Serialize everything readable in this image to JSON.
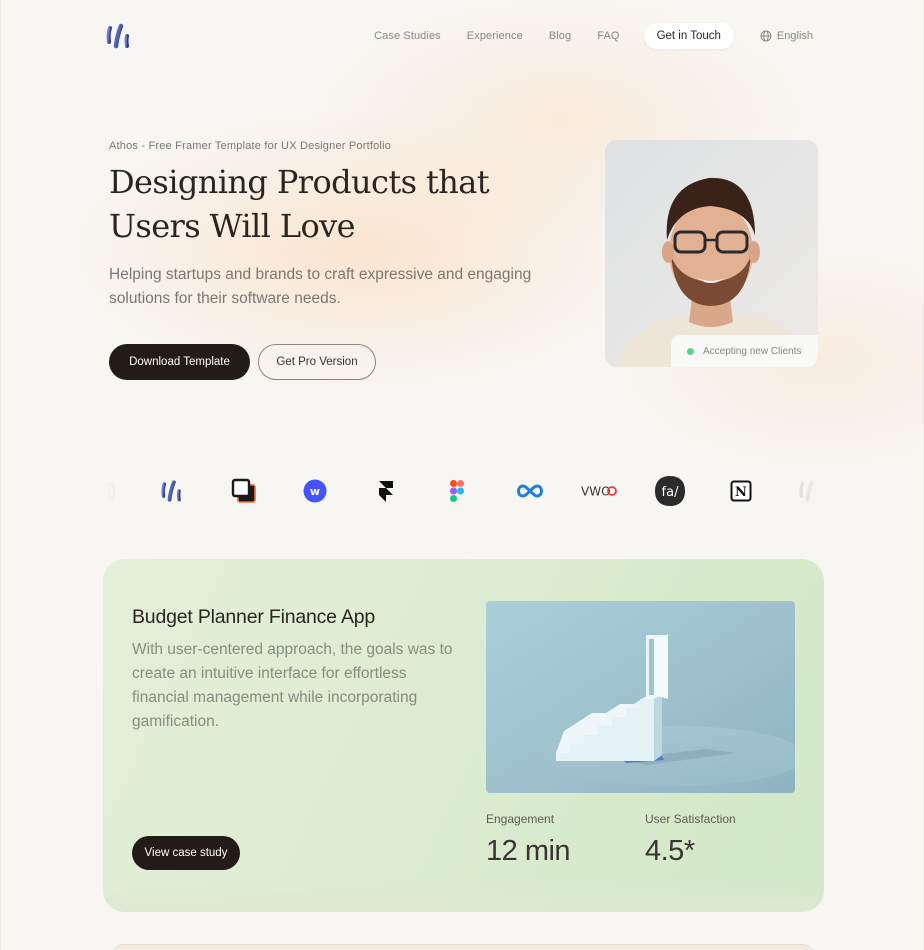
{
  "nav": {
    "links": [
      "Case Studies",
      "Experience",
      "Blog",
      "FAQ"
    ],
    "cta_label": "Get in Touch",
    "language": "English",
    "logo_icon": "athos-logo-icon",
    "globe_icon": "globe-icon"
  },
  "hero": {
    "eyebrow": "Athos - Free Framer Template for UX Designer Portfolio",
    "title_line1": "Designing Products that",
    "title_line2": "Users Will Love",
    "subtitle": "Helping startups and brands to craft expressive and engaging solutions for their software needs.",
    "primary_button": "Download Template",
    "secondary_button": "Get Pro Version",
    "availability_badge": "Accepting new Clients",
    "status_color": "#58d18a"
  },
  "logo_strip": {
    "icons": [
      "athos-logo-icon",
      "overlap-squares-logo-icon",
      "webflow-logo-icon",
      "framer-logo-icon",
      "figma-logo-icon",
      "infinity-logo-icon",
      "vwo-logo-icon",
      "fa-logo-icon",
      "notion-logo-icon"
    ],
    "vwo_text": "VWO",
    "fa_text": "fa/",
    "notion_text": "N",
    "webflow_text": "w"
  },
  "case_study": {
    "title": "Budget Planner Finance App",
    "description": "With user-centered approach, the goals was to create an intuitive interface for effortless financial management while incorporating gamification.",
    "button": "View case study",
    "stats": [
      {
        "label": "Engagement",
        "value": "12 min"
      },
      {
        "label": "User Satisfaction",
        "value": "4.5*"
      }
    ],
    "card_color": "#dcecd1"
  },
  "colors": {
    "dark": "#231b18",
    "muted_text": "#7d7671"
  }
}
